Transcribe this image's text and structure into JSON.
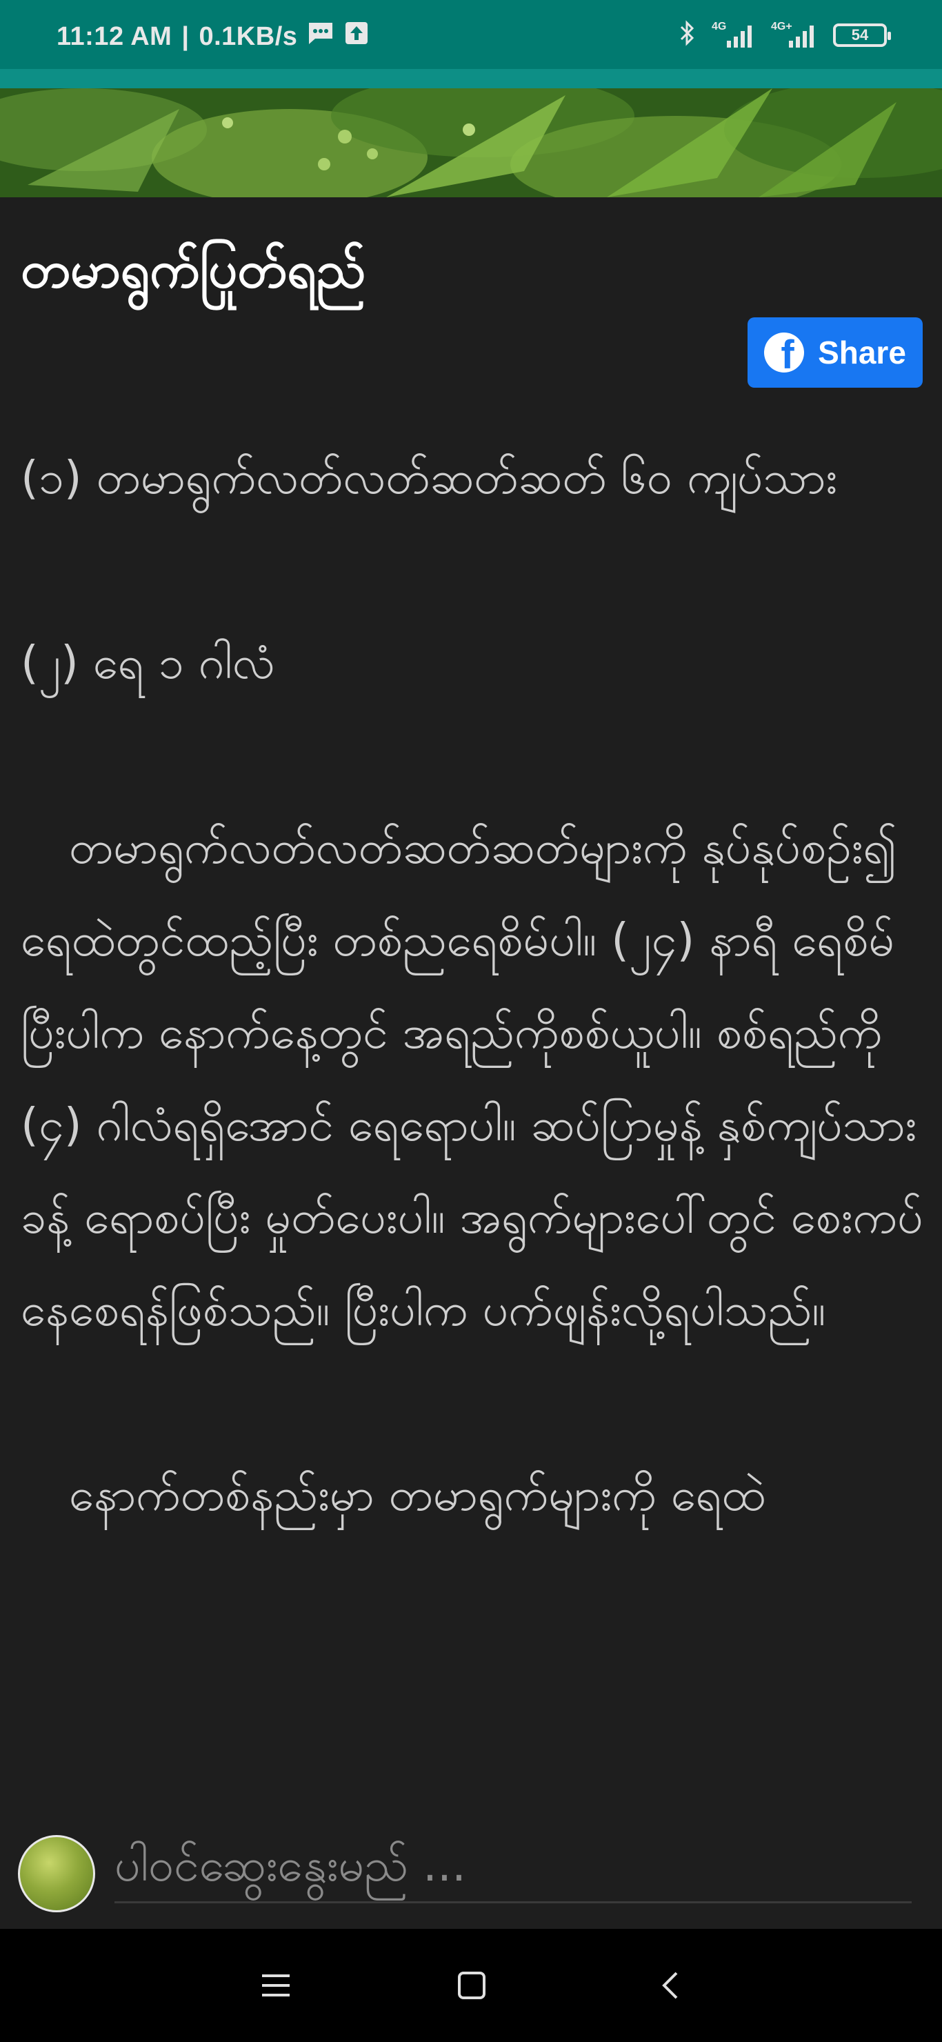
{
  "status_bar": {
    "time": "11:12 AM",
    "separator": "|",
    "speed": "0.1KB/s",
    "network_1": "4G",
    "network_2": "4G+",
    "battery": "54",
    "icons": [
      "message-icon",
      "upload-icon",
      "bluetooth-icon",
      "signal-icon",
      "signal-icon",
      "battery-icon"
    ],
    "bar_color": "#017a70"
  },
  "article": {
    "title": "တမာရွက်ပြုတ်ရည်",
    "share_label": "Share",
    "share_color": "#1877f2",
    "paragraphs": [
      "(၁) တမာရွက်လတ်လတ်ဆတ်ဆတ် ၆၀ ကျပ်သား",
      "(၂) ရေ ၁ ဂါလံ",
      "တမာရွက်လတ်လတ်ဆတ်ဆတ်များကို နုပ်နုပ်စဉ်း၍ ရေထဲတွင်ထည့်ပြီး တစ်ညရေစိမ်ပါ။ (၂၄) နာရီ ရေစိမ်ပြီးပါက နောက်နေ့တွင် အရည်ကိုစစ်ယူပါ။ စစ်ရည်ကို (၄) ဂါလံရရှိအောင် ရေရောပါ။ ဆပ်ပြာမှုန့် နှစ်ကျပ်သားခန့် ရောစပ်ပြီး မှုတ်ပေးပါ။ အရွက်များပေါ်တွင် စေးကပ်နေစေရန်ဖြစ်သည်။ ပြီးပါက ပက်ဖျန်းလို့ရပါသည်။",
      "နောက်တစ်နည်းမှာ တမာရွက်များကို ရေထဲ"
    ]
  },
  "search": {
    "placeholder": "ပါဝင်ဆွေးနွေးမည် ..."
  },
  "nav": {
    "icons": [
      "menu-icon",
      "home-icon",
      "back-icon"
    ]
  }
}
